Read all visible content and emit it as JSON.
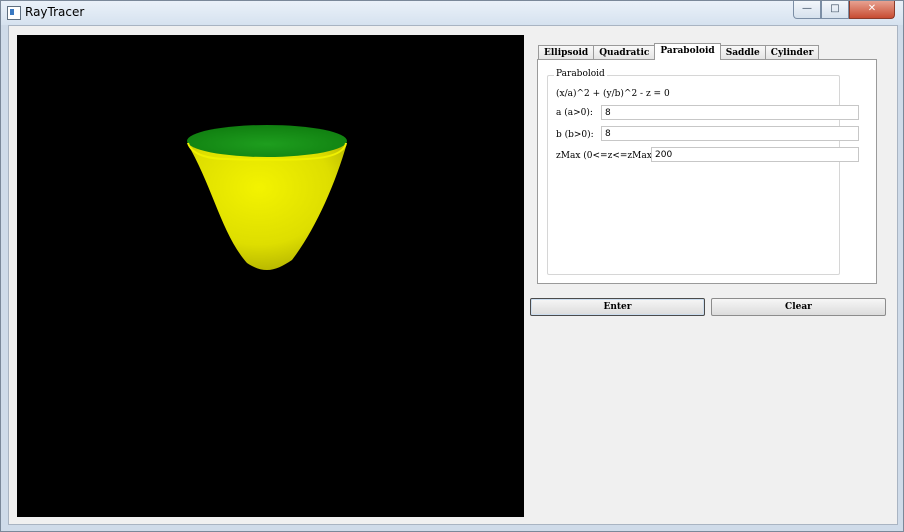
{
  "window": {
    "title": "RayTracer",
    "controls": {
      "minimize": "—",
      "maximize": "□",
      "close": "✕"
    }
  },
  "tabs": [
    {
      "label": "Ellipsoid",
      "active": false
    },
    {
      "label": "Quadratic",
      "active": false
    },
    {
      "label": "Paraboloid",
      "active": true
    },
    {
      "label": "Saddle",
      "active": false
    },
    {
      "label": "Cylinder",
      "active": false
    }
  ],
  "paraboloid": {
    "group_title": "Paraboloid",
    "equation": "(x/a)^2 + (y/b)^2 - z = 0",
    "a_label": "a (a>0):",
    "a_value": "8",
    "b_label": "b (b>0):",
    "b_value": "8",
    "zmax_label": "zMax (0<=z<=zMax):",
    "zmax_value": "200"
  },
  "buttons": {
    "enter": "Enter",
    "clear": "Clear"
  },
  "colors": {
    "surface_outer": "#e6e600",
    "surface_inner": "#138a13",
    "background": "#000000"
  }
}
